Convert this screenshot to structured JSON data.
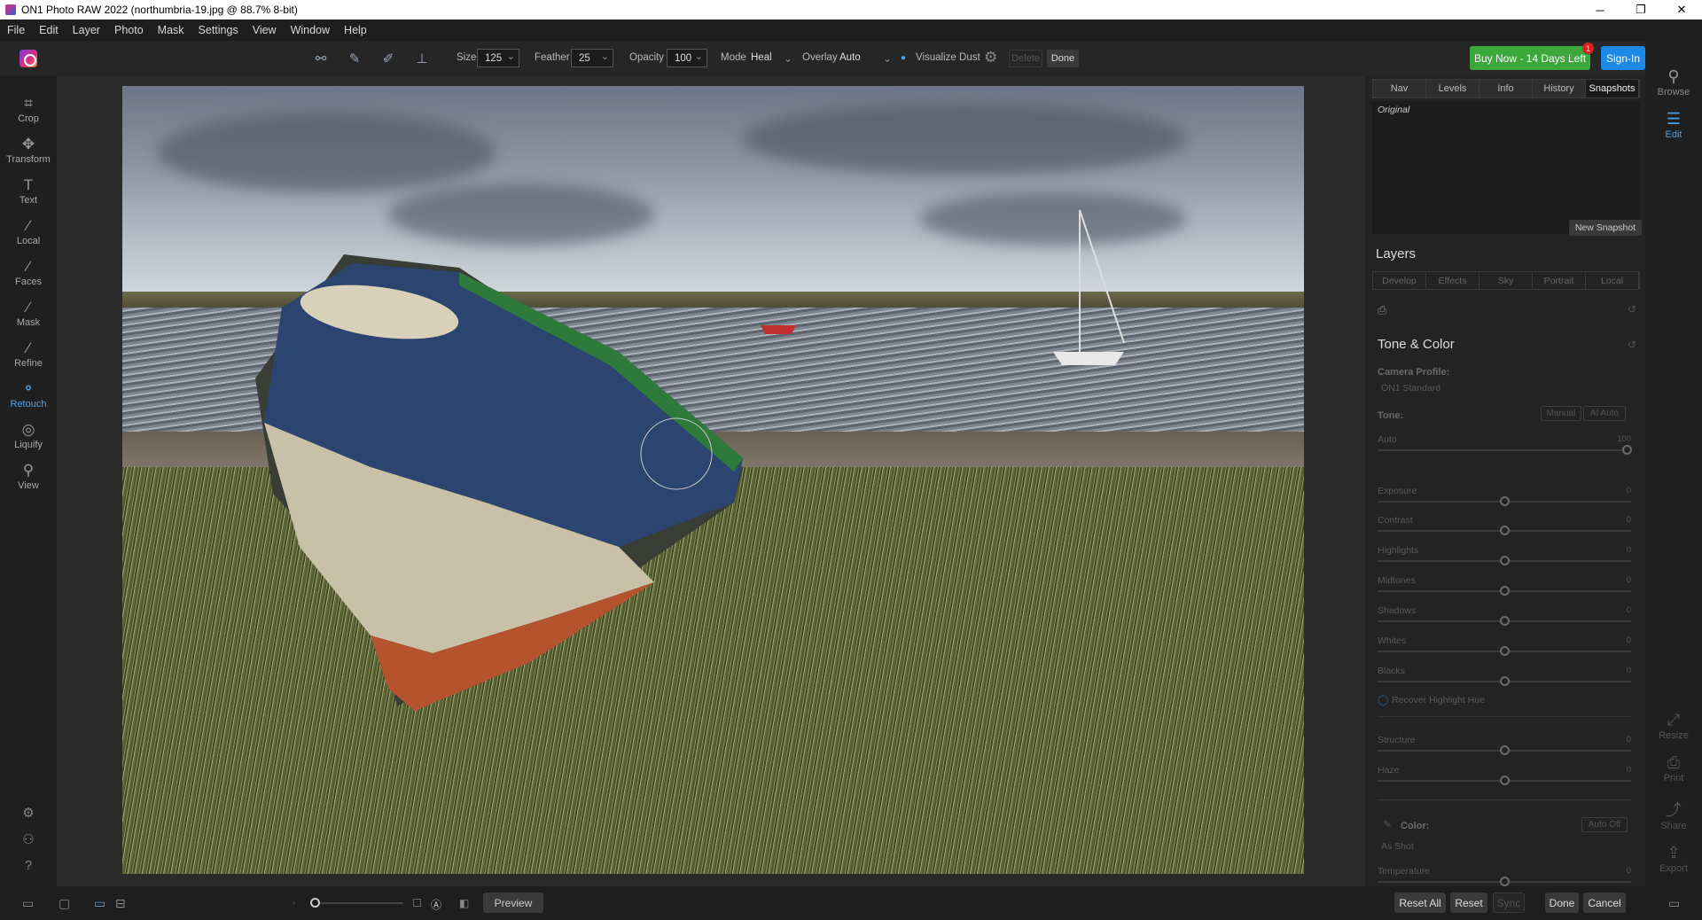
{
  "window": {
    "title": "ON1 Photo RAW 2022 (northumbria-19.jpg @ 88.7% 8-bit)",
    "controls": [
      "─",
      "❐",
      "✕"
    ]
  },
  "menu": [
    "File",
    "Edit",
    "Layer",
    "Photo",
    "Mask",
    "Settings",
    "View",
    "Window",
    "Help"
  ],
  "toolbar": {
    "size_label": "Size",
    "size_value": "125",
    "feather_label": "Feather",
    "feather_value": "25",
    "opacity_label": "Opacity",
    "opacity_value": "100",
    "mode_label": "Mode",
    "mode_value": "Heal",
    "overlay_label": "Overlay",
    "overlay_value": "Auto",
    "visualize_label": "Visualize Dust",
    "delete_label": "Delete",
    "done_label": "Done",
    "buy_label": "Buy Now - 14 Days Left",
    "buy_badge": "1",
    "signin_label": "Sign-In"
  },
  "left_tools": [
    {
      "label": "Crop",
      "icon": "⌗"
    },
    {
      "label": "Transform",
      "icon": "✥"
    },
    {
      "label": "Text",
      "icon": "T"
    },
    {
      "label": "Local",
      "icon": "⁄"
    },
    {
      "label": "Faces",
      "icon": "⁄"
    },
    {
      "label": "Mask",
      "icon": "⁄"
    },
    {
      "label": "Refine",
      "icon": "⁄"
    },
    {
      "label": "Retouch",
      "icon": "⚬"
    },
    {
      "label": "Liquify",
      "icon": "◎"
    },
    {
      "label": "View",
      "icon": "⚲"
    }
  ],
  "right_panel": {
    "tabs": [
      "Nav",
      "Levels",
      "Info",
      "History",
      "Snapshots"
    ],
    "active_tab": "Snapshots",
    "snapshot_original": "Original",
    "new_snapshot": "New Snapshot",
    "layers_title": "Layers",
    "layer_tabs": [
      "Develop",
      "Effects",
      "Sky",
      "Portrait",
      "Local"
    ],
    "tone_color_title": "Tone & Color",
    "camera_profile_label": "Camera Profile:",
    "camera_profile_value": "ON1 Standard",
    "tone_label": "Tone:",
    "manual_btn": "Manual",
    "ai_auto_btn": "AI Auto",
    "auto_label": "Auto",
    "auto_value": "100",
    "sliders": [
      {
        "label": "Exposure",
        "value": "0"
      },
      {
        "label": "Contrast",
        "value": "0"
      },
      {
        "label": "Highlights",
        "value": "0"
      },
      {
        "label": "Midtones",
        "value": "0"
      },
      {
        "label": "Shadows",
        "value": "0"
      },
      {
        "label": "Whites",
        "value": "0"
      },
      {
        "label": "Blacks",
        "value": "0"
      }
    ],
    "recover_label": "Recover Highlight Hue",
    "sliders2": [
      {
        "label": "Structure",
        "value": "0"
      },
      {
        "label": "Haze",
        "value": "0"
      }
    ],
    "color_label": "Color:",
    "auto_off_btn": "Auto Off",
    "as_shot": "As Shot",
    "temperature_label": "Temperature",
    "temperature_value": "0"
  },
  "right_side": [
    {
      "label": "Browse",
      "icon": "⚲"
    },
    {
      "label": "Edit",
      "icon": "☰"
    },
    {
      "label": "Resize",
      "icon": "⤢"
    },
    {
      "label": "Print",
      "icon": "⎙"
    },
    {
      "label": "Share",
      "icon": "⤴"
    },
    {
      "label": "Export",
      "icon": "⇪"
    }
  ],
  "bottom": {
    "preview_label": "Preview",
    "reset_all": "Reset All",
    "reset": "Reset",
    "sync": "Sync",
    "done": "Done",
    "cancel": "Cancel"
  }
}
